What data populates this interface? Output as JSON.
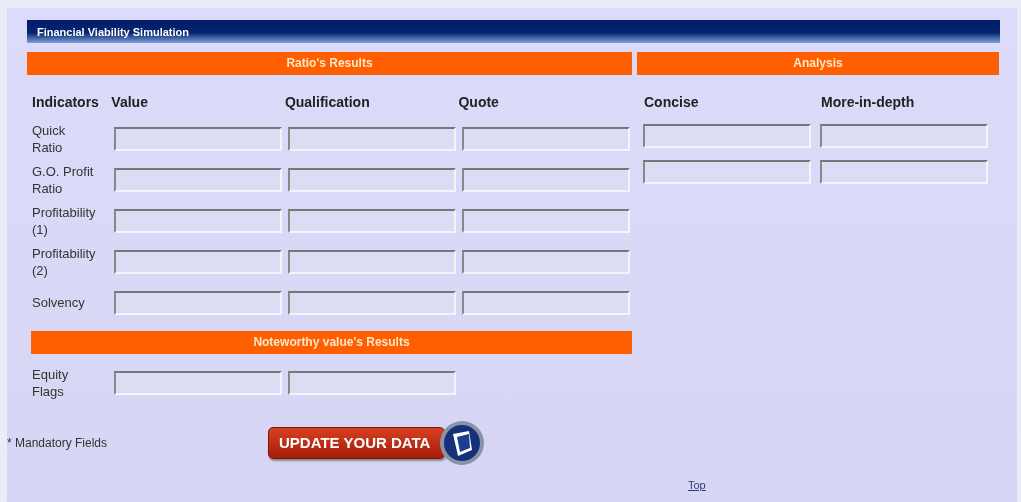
{
  "window": {
    "title": "Financial Viability Simulation"
  },
  "ratio_results": {
    "heading": "Ratio's Results",
    "row_header": "Indicators",
    "columns": [
      "Value",
      "Qualification",
      "Quote"
    ],
    "rows": [
      {
        "label": "Quick\nRatio",
        "fields": [
          {
            "kind": "text"
          },
          {
            "kind": "text"
          },
          {
            "kind": "text"
          }
        ]
      },
      {
        "label": "G.O. Profit\nRatio",
        "fields": [
          {
            "kind": "text"
          },
          {
            "kind": "text"
          },
          {
            "kind": "text"
          }
        ]
      },
      {
        "label": "Profitability\n(1)",
        "fields": [
          {
            "kind": "text"
          },
          {
            "kind": "text"
          },
          {
            "kind": "text"
          }
        ]
      },
      {
        "label": "Profitability\n(2)",
        "fields": [
          {
            "kind": "text"
          },
          {
            "kind": "text"
          },
          {
            "kind": "text"
          }
        ]
      },
      {
        "label": "Solvency",
        "fields": [
          {
            "kind": "text"
          },
          {
            "kind": "text"
          },
          {
            "kind": "text"
          }
        ]
      }
    ]
  },
  "noteworthy_results": {
    "heading": "Noteworthy value's Results",
    "rows": [
      {
        "label": "Equity\nFlags",
        "fields": [
          {
            "kind": "text"
          },
          {
            "kind": "text"
          }
        ]
      }
    ]
  },
  "analysis": {
    "heading": "Analysis",
    "columns": [
      "Concise",
      "More-in-depth"
    ],
    "rows": [
      {
        "fields": [
          {
            "kind": "text"
          },
          {
            "kind": "text"
          }
        ]
      },
      {
        "fields": [
          {
            "kind": "text"
          },
          {
            "kind": "text"
          }
        ]
      }
    ]
  },
  "mandatory_note": "* Mandatory Fields",
  "update_button": {
    "label": "UPDATE YOUR DATA"
  },
  "top_link": "Top"
}
